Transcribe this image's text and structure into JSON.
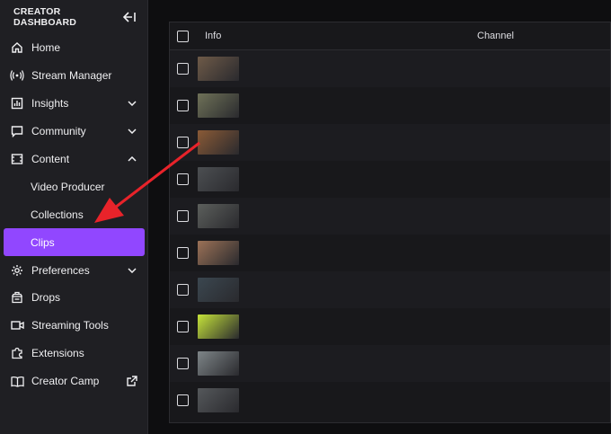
{
  "sidebar": {
    "title": "CREATOR DASHBOARD",
    "items": [
      {
        "label": "Home",
        "icon": "home-icon",
        "chevron": ""
      },
      {
        "label": "Stream Manager",
        "icon": "broadcast-icon",
        "chevron": ""
      },
      {
        "label": "Insights",
        "icon": "insights-icon",
        "chevron": "down"
      },
      {
        "label": "Community",
        "icon": "community-icon",
        "chevron": "down"
      },
      {
        "label": "Content",
        "icon": "content-icon",
        "chevron": "up"
      },
      {
        "label": "Video Producer",
        "icon": "",
        "chevron": ""
      },
      {
        "label": "Collections",
        "icon": "",
        "chevron": ""
      },
      {
        "label": "Clips",
        "icon": "",
        "chevron": ""
      },
      {
        "label": "Preferences",
        "icon": "gear-icon",
        "chevron": "down"
      },
      {
        "label": "Drops",
        "icon": "drops-icon",
        "chevron": ""
      },
      {
        "label": "Streaming Tools",
        "icon": "camera-icon",
        "chevron": ""
      },
      {
        "label": "Extensions",
        "icon": "puzzle-icon",
        "chevron": ""
      },
      {
        "label": "Creator Camp",
        "icon": "book-icon",
        "chevron": "external"
      }
    ]
  },
  "table": {
    "headers": {
      "info": "Info",
      "channel": "Channel"
    },
    "rows": [
      {
        "title": "",
        "channel": "",
        "thumb_color": "#6e5a48"
      },
      {
        "title": "",
        "channel": "",
        "thumb_color": "#6f7258"
      },
      {
        "title": "",
        "channel": "",
        "thumb_color": "#8a5a36"
      },
      {
        "title": "",
        "channel": "",
        "thumb_color": "#4c4f52"
      },
      {
        "title": "",
        "channel": "",
        "thumb_color": "#5c5f5c"
      },
      {
        "title": "",
        "channel": "",
        "thumb_color": "#9c7257"
      },
      {
        "title": "",
        "channel": "",
        "thumb_color": "#3b4750"
      },
      {
        "title": "",
        "channel": "",
        "thumb_color": "#c6e43a"
      },
      {
        "title": "",
        "channel": "",
        "thumb_color": "#7e8588"
      },
      {
        "title": "",
        "channel": "",
        "thumb_color": "#55585b"
      }
    ]
  },
  "colors": {
    "accent": "#9147ff",
    "annotation_arrow": "#e8232a"
  }
}
